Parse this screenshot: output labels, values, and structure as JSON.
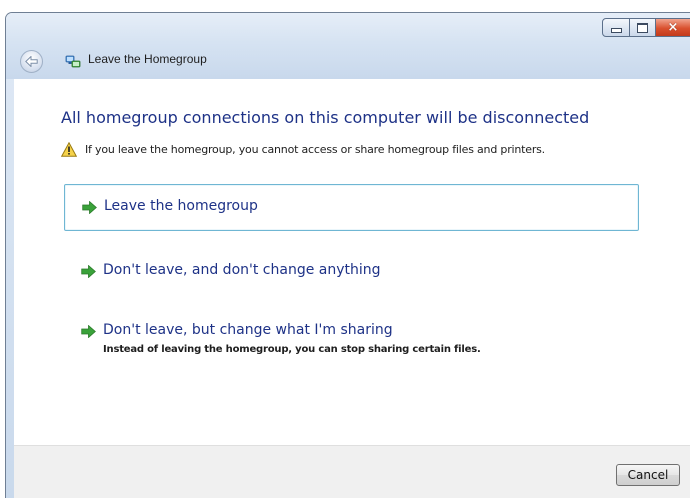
{
  "window": {
    "title": "Leave the Homegroup",
    "buttons": {
      "minimize": "minimize",
      "maximize": "maximize",
      "close": "×"
    }
  },
  "main": {
    "heading": "All homegroup connections on this computer will be disconnected",
    "warning": "If you leave the homegroup, you cannot access or share homegroup files and printers.",
    "options": [
      {
        "label": "Leave the homegroup",
        "description": ""
      },
      {
        "label": "Don't leave, and don't change anything",
        "description": ""
      },
      {
        "label": "Don't leave, but change what I'm sharing",
        "description": "Instead of leaving the homegroup, you can stop sharing certain files."
      }
    ]
  },
  "footer": {
    "cancel_label": "Cancel"
  },
  "icons": {
    "back": "back-arrow-icon",
    "title": "homegroup-icon",
    "warning": "warning-triangle-icon",
    "option": "green-arrow-icon"
  },
  "colors": {
    "link_blue": "#1e3287",
    "selection_border": "#6fb6d3",
    "warning_yellow": "#f5d24a",
    "arrow_green": "#3aa23a",
    "close_red": "#d9502e"
  }
}
